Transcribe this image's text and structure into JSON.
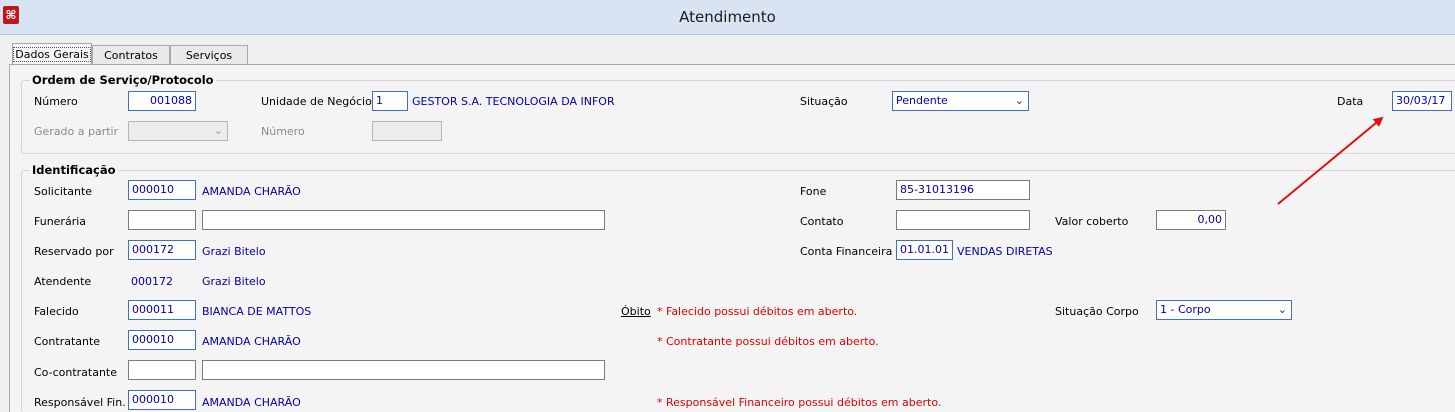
{
  "window": {
    "title": "Atendimento",
    "app_icon": "app-logo-icon"
  },
  "tabs": [
    {
      "label": "Dados Gerais",
      "active": true
    },
    {
      "label": "Contratos",
      "active": false
    },
    {
      "label": "Serviços",
      "active": false
    }
  ],
  "ordem": {
    "legend": "Ordem de Serviço/Protocolo",
    "numero_label": "Número",
    "numero_value": "001088",
    "unidade_label": "Unidade de Negócio",
    "unidade_code": "1",
    "unidade_name": "GESTOR S.A. TECNOLOGIA DA INFOR",
    "situacao_label": "Situação",
    "situacao_value": "Pendente",
    "data_label": "Data",
    "data_value": "30/03/17",
    "gerado_label": "Gerado a partir",
    "gerado_value": "",
    "numero2_label": "Número",
    "numero2_value": ""
  },
  "ident": {
    "legend": "Identificação",
    "solicitante_label": "Solicitante",
    "solicitante_code": "000010",
    "solicitante_name": "AMANDA CHARÃO",
    "fone_label": "Fone",
    "fone_value": "85-31013196",
    "funeraria_label": "Funerária",
    "funeraria_code": "",
    "funeraria_name": "",
    "contato_label": "Contato",
    "contato_value": "",
    "valor_label": "Valor coberto",
    "valor_value": "0,00",
    "reservado_label": "Reservado por",
    "reservado_code": "000172",
    "reservado_name": "Grazi Bitelo",
    "conta_label": "Conta Financeira",
    "conta_code": "01.01.01",
    "conta_name": "VENDAS DIRETAS",
    "atendente_label": "Atendente",
    "atendente_code": "000172",
    "atendente_name": "Grazi Bitelo",
    "falecido_label": "Falecido",
    "falecido_code": "000011",
    "falecido_name": "BIANCA DE MATTOS",
    "obito_link": "Óbito",
    "falecido_warn": "* Falecido possui débitos em aberto.",
    "situacao_corpo_label": "Situação Corpo",
    "situacao_corpo_value": "1 - Corpo",
    "contratante_label": "Contratante",
    "contratante_code": "000010",
    "contratante_name": "AMANDA CHARÃO",
    "contratante_warn": "* Contratante possui débitos em aberto.",
    "cocontratante_label": "Co-contratante",
    "cocontratante_code": "",
    "cocontratante_name": "",
    "responsavel_label": "Responsável Fin.",
    "responsavel_code": "000010",
    "responsavel_name": "AMANDA CHARÃO",
    "responsavel_warn": "* Responsável Financeiro possui débitos em aberto."
  },
  "annotation": {
    "arrow_color": "#e01010"
  },
  "colors": {
    "value_text": "#0000aa",
    "warning": "#e00000",
    "title_bar": "#d9e4f2"
  }
}
